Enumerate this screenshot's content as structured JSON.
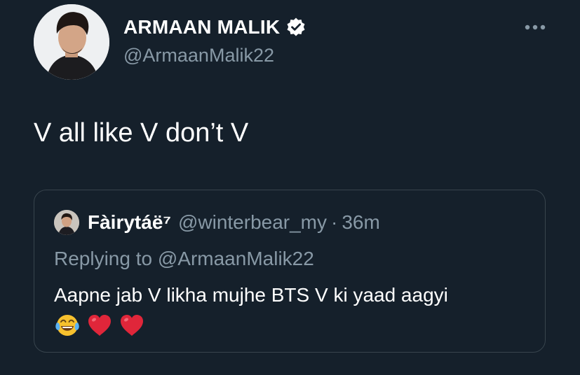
{
  "author": {
    "display_name": "ARMAAN MALIK",
    "handle": "@ArmaanMalik22",
    "verified": true
  },
  "tweet": {
    "text": "V all like V don’t V"
  },
  "quoted_tweet": {
    "display_name": "Fàirytáë⁷",
    "handle": "@winterbear_my",
    "separator": "·",
    "time": "36m",
    "reply_context": "Replying to @ArmaanMalik22",
    "text": "Aapne jab V likha mujhe BTS V ki yaad aagyi",
    "emojis": [
      "face-with-tears-of-joy-icon",
      "red-heart-icon",
      "red-heart-icon"
    ]
  },
  "colors": {
    "background": "#15202b",
    "primary_text": "#ffffff",
    "secondary_text": "#8899a6",
    "border": "#38444d",
    "heart": "#e0263a",
    "emoji_face": "#f7c12e"
  }
}
